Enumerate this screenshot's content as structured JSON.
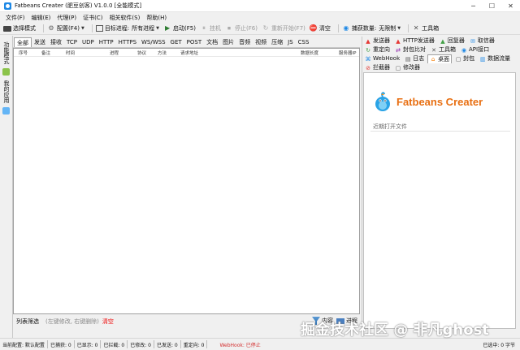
{
  "window": {
    "title": "Fatbeans Creater (肥豆创客) V1.0.0 [全能模式]"
  },
  "menu": [
    "文件(F)",
    "编辑(E)",
    "代理(P)",
    "证书(C)",
    "相关软件(S)",
    "帮助(H)"
  ],
  "toolbar": {
    "select_mode": "选择模式",
    "config": "配置(F4)",
    "target_process_label": "目标进程:",
    "target_process_value": "所有进程",
    "start": "启动(F5)",
    "hang": "挂机",
    "stop": "停止(F6)",
    "restart": "重新开始(F7)",
    "clear": "清空",
    "capture_count_label": "捕获数量:",
    "capture_count_value": "无限制",
    "toolbox": "工具箱"
  },
  "sidebar": {
    "tab1": "功能模式",
    "tab2": "我的应用"
  },
  "filter_tabs": [
    "全部",
    "发送",
    "接收",
    "TCP",
    "UDP",
    "HTTP",
    "HTTPS",
    "WS/WSS",
    "GET",
    "POST",
    "文档",
    "图片",
    "音频",
    "视频",
    "压缩",
    "JS",
    "CSS"
  ],
  "grid_columns": [
    "序号",
    "备注",
    "时间",
    "进程",
    "协议",
    "方法",
    "请求地址",
    "数据长度",
    "服务器IP"
  ],
  "bottom": {
    "filter_label": "列表筛选",
    "filter_hint": "(左键修改, 右键删除)",
    "clear": "清空",
    "content": "内容",
    "process": "进程"
  },
  "right_tabs": [
    {
      "label": "发送器",
      "icon": "arrow-up-icon",
      "color": "#e53935",
      "glyph": "▲"
    },
    {
      "label": "HTTP发送器",
      "icon": "arrow-up-icon",
      "color": "#e53935",
      "glyph": "▲"
    },
    {
      "label": "回复器",
      "icon": "arrow-up-icon",
      "color": "#43a047",
      "glyph": "▲"
    },
    {
      "label": "取信器",
      "icon": "mail-icon",
      "color": "#1e88e5",
      "glyph": "✉"
    },
    {
      "label": "重定向",
      "icon": "redirect-icon",
      "color": "#43a047",
      "glyph": "↻"
    },
    {
      "label": "封包比对",
      "icon": "compare-icon",
      "color": "#8e24aa",
      "glyph": "⇄"
    },
    {
      "label": "工具箱",
      "icon": "wrench-icon",
      "color": "#555555",
      "glyph": "✕"
    },
    {
      "label": "API接口",
      "icon": "api-icon",
      "color": "#1e88e5",
      "glyph": "◉"
    },
    {
      "label": "WebHook",
      "icon": "webhook-icon",
      "color": "#1e88e5",
      "glyph": "⌘"
    },
    {
      "label": "日志",
      "icon": "log-icon",
      "color": "#555555",
      "glyph": "▤"
    },
    {
      "label": "桌面",
      "icon": "desktop-icon",
      "color": "#f57c00",
      "glyph": "⌂",
      "active": true
    },
    {
      "label": "封包",
      "icon": "packet-icon",
      "color": "#555555",
      "glyph": "▢"
    },
    {
      "label": "数据流量",
      "icon": "chart-icon",
      "color": "#1e88e5",
      "glyph": "▥"
    },
    {
      "label": "拦截器",
      "icon": "block-icon",
      "color": "#e53935",
      "glyph": "⊘"
    },
    {
      "label": "修改器",
      "icon": "edit-icon",
      "color": "#555555",
      "glyph": "▢"
    }
  ],
  "right_panel": {
    "logo_text": "Fatbeans Creater",
    "recent": "近期打开文件"
  },
  "status": {
    "config": "当前配置: 默认配置",
    "captured": "已捕获: 0",
    "shown": "已显示: 0",
    "blocked": "已拦截: 0",
    "modified": "已修改: 0",
    "sent": "已发送: 0",
    "redirected": "重定向: 0",
    "webhook": "WebHook: 已停止",
    "selected": "已选中: 0 字节"
  },
  "watermark": "掘金技术社区 @ 非凡ghost"
}
